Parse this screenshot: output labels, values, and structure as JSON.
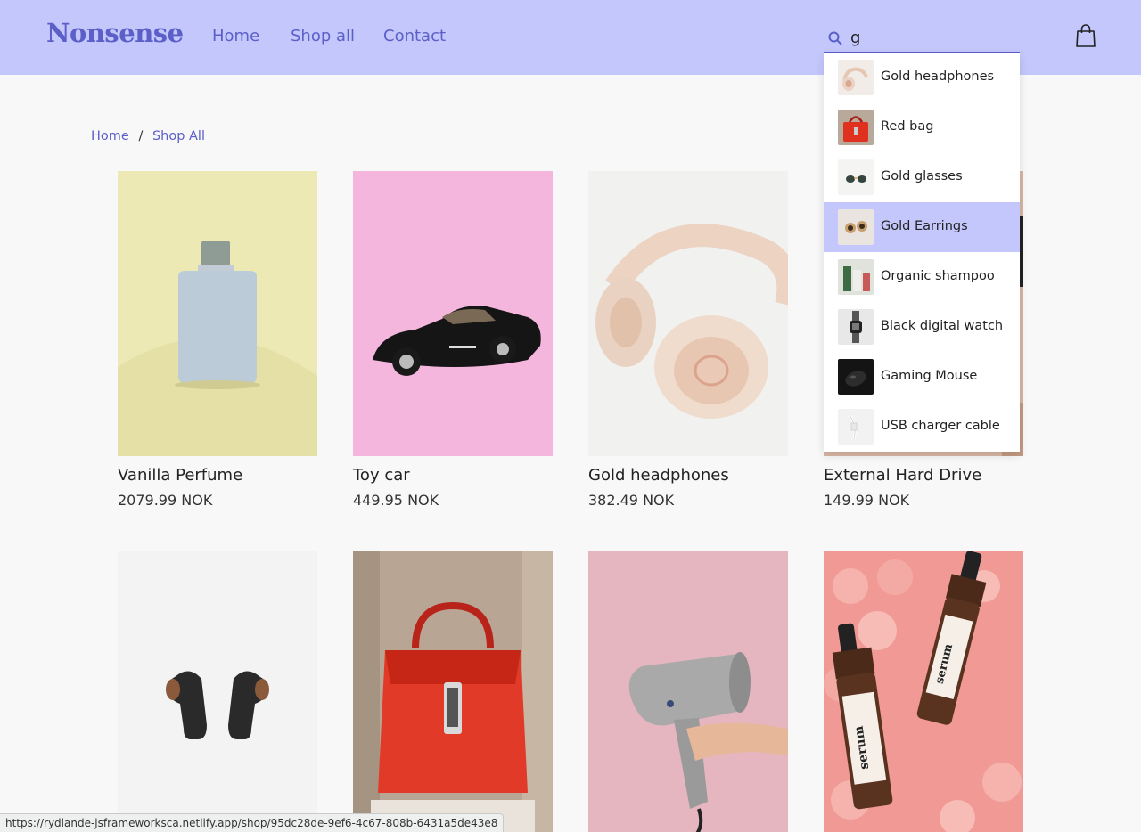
{
  "header": {
    "logo": "Nonsense",
    "nav": [
      {
        "label": "Home"
      },
      {
        "label": "Shop all"
      },
      {
        "label": "Contact"
      }
    ],
    "search": {
      "value": "g",
      "placeholder": ""
    },
    "accent_color": "#5b5fc7",
    "background_color": "#c3c7fb"
  },
  "search_results": [
    {
      "label": "Gold headphones",
      "icon": "headphones-thumbnail"
    },
    {
      "label": "Red bag",
      "icon": "bag-thumbnail"
    },
    {
      "label": "Gold glasses",
      "icon": "glasses-thumbnail"
    },
    {
      "label": "Gold Earrings",
      "icon": "earrings-thumbnail",
      "highlighted": true
    },
    {
      "label": "Organic shampoo",
      "icon": "shampoo-thumbnail"
    },
    {
      "label": "Black digital watch",
      "icon": "watch-thumbnail"
    },
    {
      "label": "Gaming Mouse",
      "icon": "mouse-thumbnail"
    },
    {
      "label": "USB charger cable",
      "icon": "cable-thumbnail"
    }
  ],
  "breadcrumb": {
    "home": "Home",
    "separator": "/",
    "current": "Shop All"
  },
  "products": [
    {
      "name": "Vanilla Perfume",
      "price": "2079.99 NOK",
      "image": "perfume-image"
    },
    {
      "name": "Toy car",
      "price": "449.95 NOK",
      "image": "toy-car-image"
    },
    {
      "name": "Gold headphones",
      "price": "382.49 NOK",
      "image": "headphones-image"
    },
    {
      "name": "External Hard Drive",
      "price": "149.99 NOK",
      "image": "hard-drive-image"
    },
    {
      "name": "",
      "price": "",
      "image": "earbuds-image"
    },
    {
      "name": "",
      "price": "",
      "image": "red-bag-image"
    },
    {
      "name": "",
      "price": "",
      "image": "hair-dryer-image"
    },
    {
      "name": "",
      "price": "",
      "image": "serum-image"
    }
  ],
  "status_bar": {
    "url": "https://rydlande-jsframeworksca.netlify.app/shop/95dc28de-9ef6-4c67-808b-6431a5de43e8"
  }
}
